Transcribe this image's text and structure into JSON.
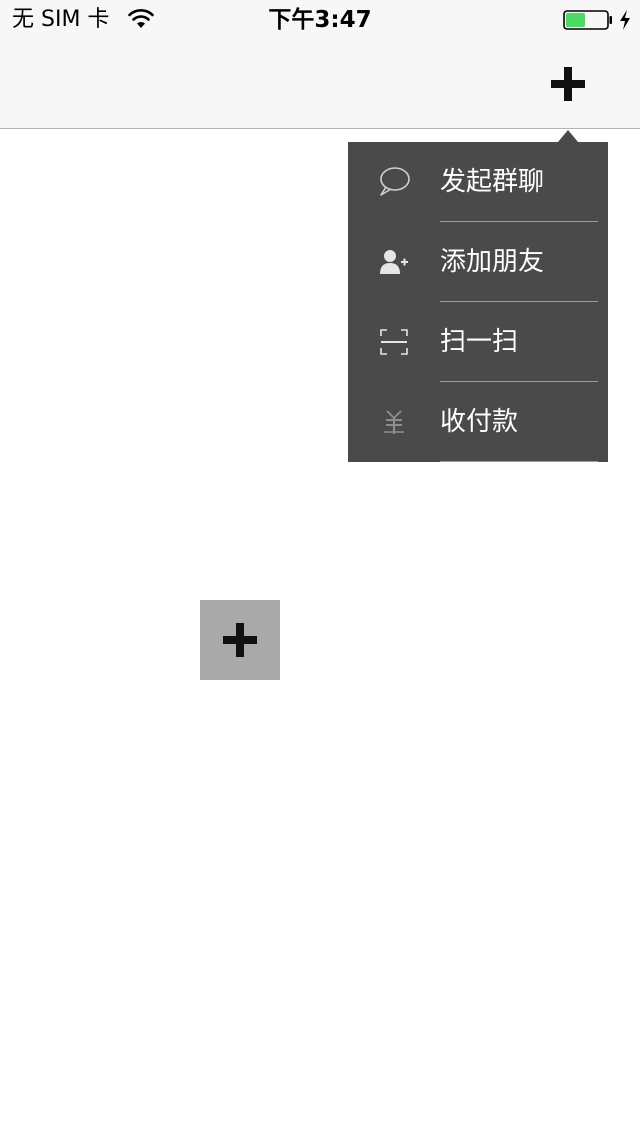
{
  "status_bar": {
    "carrier": "无 SIM 卡",
    "time": "下午3:47",
    "battery_color": "#4cd964"
  },
  "nav_bar": {
    "add_icon": "plus-icon"
  },
  "popup_menu": {
    "items": [
      {
        "label": "发起群聊",
        "icon": "chat-bubble-icon"
      },
      {
        "label": "添加朋友",
        "icon": "add-friend-icon"
      },
      {
        "label": "扫一扫",
        "icon": "scan-icon"
      },
      {
        "label": "收付款",
        "icon": "payment-icon"
      }
    ]
  },
  "center_button": {
    "icon": "plus-icon"
  }
}
